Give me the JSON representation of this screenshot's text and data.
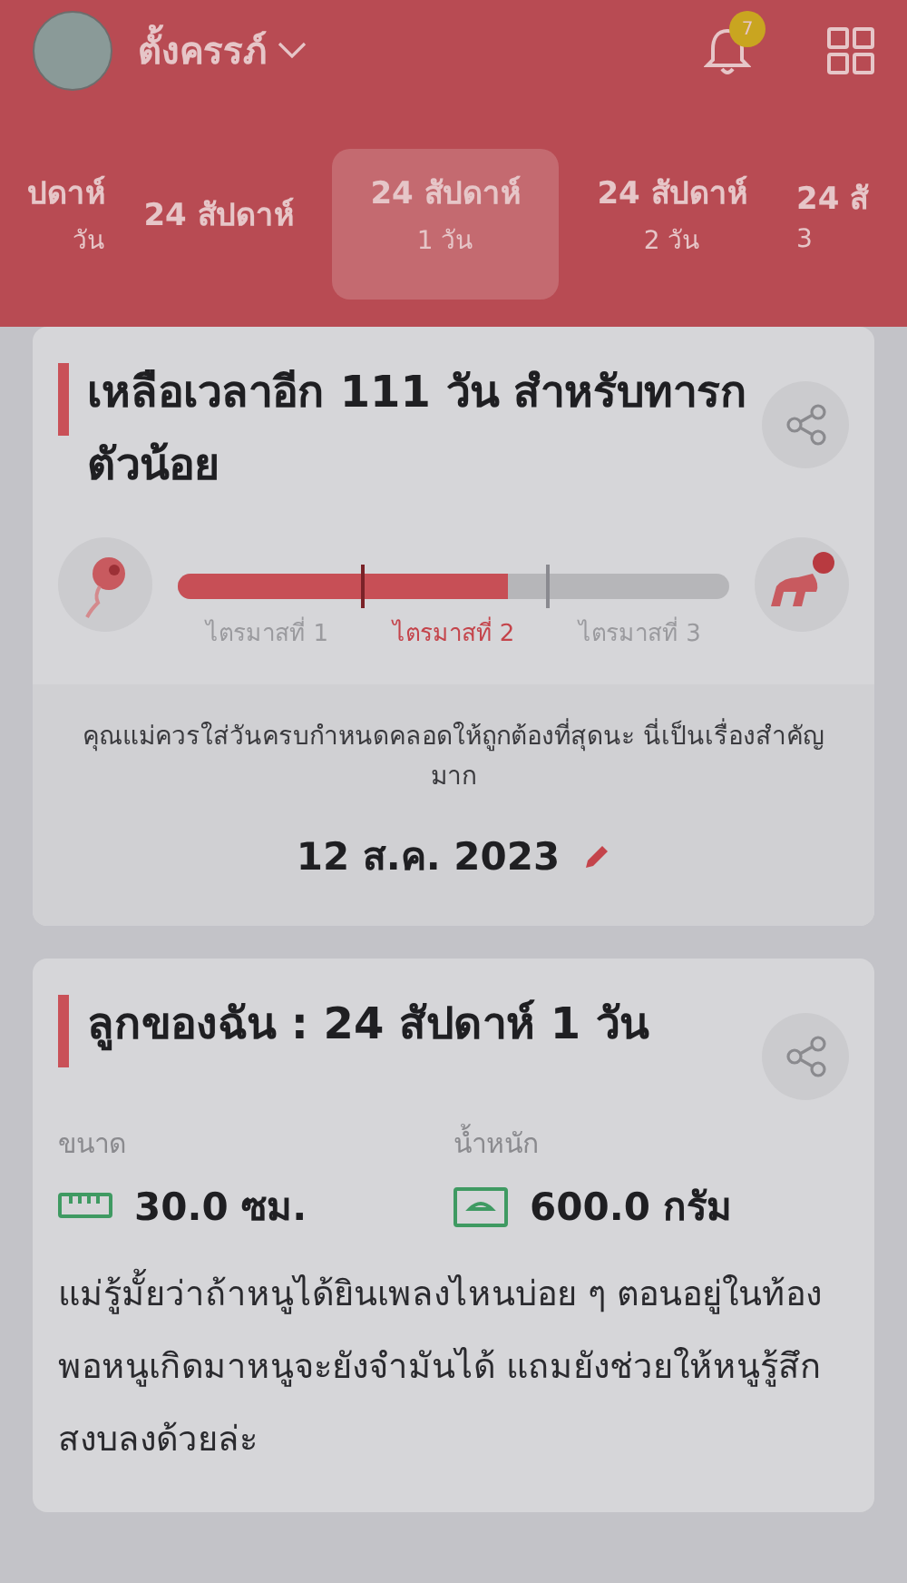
{
  "header": {
    "profile_name": "ตั้งครรภ์",
    "notification_count": "7"
  },
  "week_tabs": [
    {
      "week": "ปดาห์",
      "day": "วัน",
      "selected": false
    },
    {
      "week": "24 สัปดาห์",
      "selected": false
    },
    {
      "week": "24 สัปดาห์",
      "day": "1 วัน",
      "selected": true
    },
    {
      "week": "24 สัปดาห์",
      "day": "2 วัน",
      "selected": false
    },
    {
      "week": "24 สั",
      "day": "3",
      "selected": false
    }
  ],
  "countdown_card": {
    "title": "เหลือเวลาอีก 111 วัน สำหรับทารกตัวน้อย",
    "level": 0.6,
    "trimesters": [
      {
        "label": "ไตรมาสที่ 1",
        "current": false
      },
      {
        "label": "ไตรมาสที่ 2",
        "current": true
      },
      {
        "label": "ไตรมาสที่ 3",
        "current": false
      }
    ],
    "note": "คุณแม่ควรใส่วันครบกำหนดคลอดให้ถูกต้องที่สุดนะ นี่เป็นเรื่องสำคัญมาก",
    "due_date": "12 ส.ค. 2023"
  },
  "baby_card": {
    "title": "ลูกของฉัน : 24 สัปดาห์ 1 วัน",
    "stats": [
      {
        "kind": "size",
        "label": "ขนาด",
        "value": "30.0 ซม."
      },
      {
        "kind": "weight",
        "label": "น้ำหนัก",
        "value": "600.0 กรัม"
      }
    ],
    "text": "แม่รู้มั้ยว่าถ้าหนูได้ยินเพลงไหนบ่อย ๆ ตอนอยู่ในท้อง พอหนูเกิดมาหนูจะยังจำมันได้ แถมยังช่วยให้หนูรู้สึกสงบลงด้วยล่ะ"
  }
}
